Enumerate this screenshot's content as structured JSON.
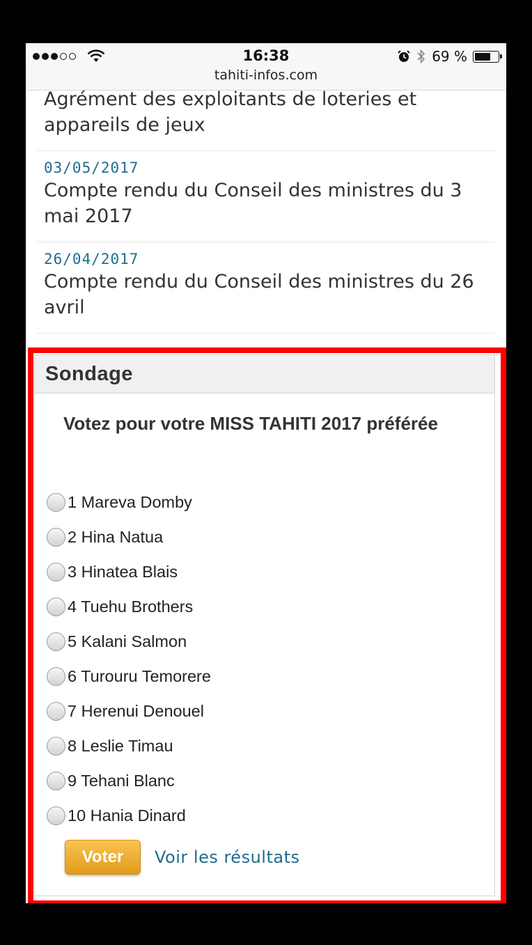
{
  "status_bar": {
    "time": "16:38",
    "url": "tahiti-infos.com",
    "battery_text": "69 %",
    "battery_level": 0.69,
    "signal_bars": 3
  },
  "articles": [
    {
      "date": "",
      "title": "Agrément des exploitants de loteries et appareils de jeux"
    },
    {
      "date": "03/05/2017",
      "title": "Compte rendu du Conseil des ministres du 3 mai 2017"
    },
    {
      "date": "26/04/2017",
      "title": "Compte rendu du Conseil des ministres du 26 avril"
    }
  ],
  "poll": {
    "header": "Sondage",
    "question": "Votez pour votre MISS TAHITI 2017 préférée",
    "options": [
      "1 Mareva Domby",
      "2 Hina Natua",
      "3 Hinatea Blais",
      "4 Tuehu Brothers",
      "5 Kalani Salmon",
      "6 Turouru Temorere",
      "7 Herenui Denouel",
      "8 Leslie Timau",
      "9 Tehani Blanc",
      "10 Hania Dinard"
    ],
    "vote_label": "Voter",
    "results_label": "Voir les résultats"
  },
  "colors": {
    "link": "#1f6d8c",
    "highlight_frame": "#ff0000",
    "vote_button": "#f0ad2e"
  }
}
